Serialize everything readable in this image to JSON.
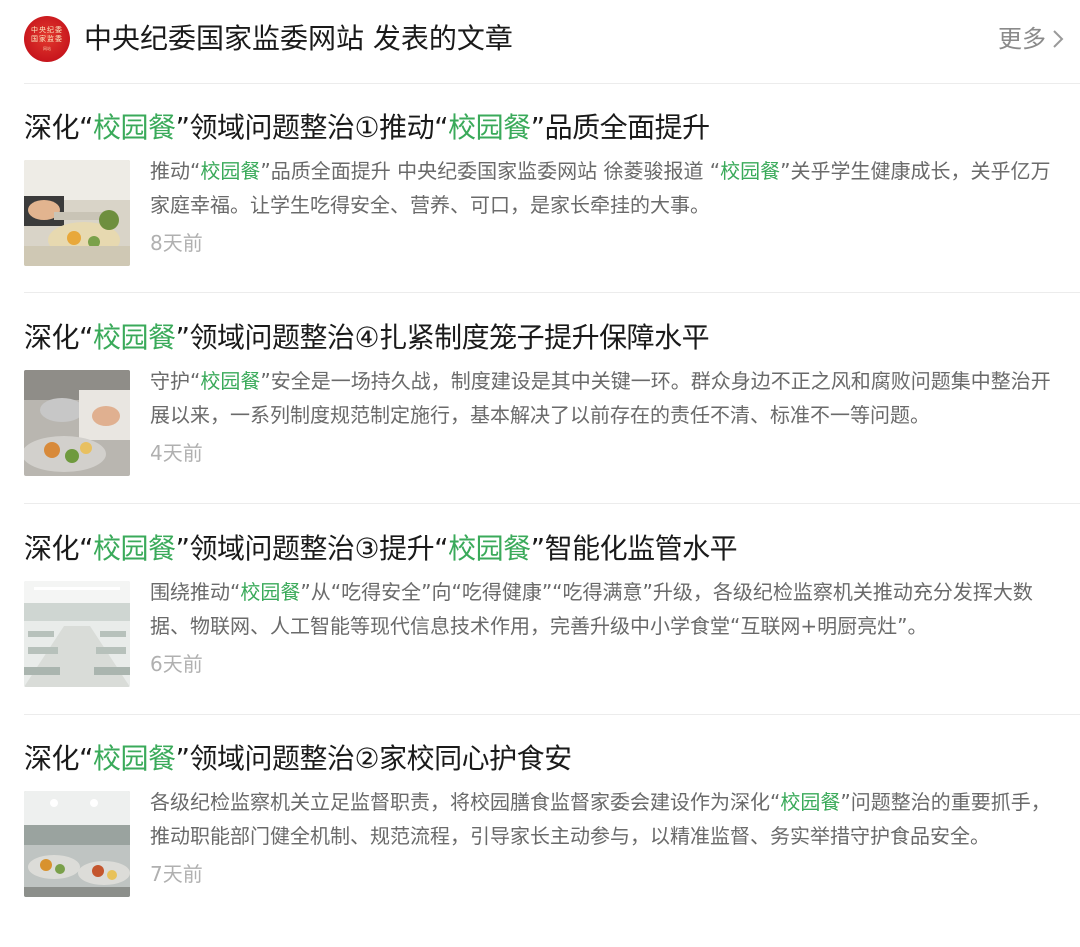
{
  "header": {
    "avatar_text": [
      "中央纪委",
      "国家监委",
      "网站"
    ],
    "title": "中央纪委国家监委网站 发表的文章",
    "more_label": "更多"
  },
  "colors": {
    "highlight": "#3aaa5a",
    "brand_red": "#c8161d"
  },
  "articles": [
    {
      "title": [
        {
          "t": "深化“",
          "h": false
        },
        {
          "t": "校园餐",
          "h": true
        },
        {
          "t": "”领域问题整治①推动“",
          "h": false
        },
        {
          "t": "校园餐",
          "h": true
        },
        {
          "t": "”品质全面提升",
          "h": false
        }
      ],
      "summary": [
        {
          "t": "推动“",
          "h": false
        },
        {
          "t": "校园餐",
          "h": true
        },
        {
          "t": "”品质全面提升 中央纪委国家监委网站 徐菱骏报道 “",
          "h": false
        },
        {
          "t": "校园餐",
          "h": true
        },
        {
          "t": "”关乎学生健康成长，关乎亿万家庭幸福。让学生吃得安全、营养、可口，是家长牵挂的大事。",
          "h": false
        }
      ],
      "time": "8天前",
      "thumb_icon": "cafeteria-food-photo-icon"
    },
    {
      "title": [
        {
          "t": "深化“",
          "h": false
        },
        {
          "t": "校园餐",
          "h": true
        },
        {
          "t": "”领域问题整治④扎紧制度笼子提升保障水平",
          "h": false
        }
      ],
      "summary": [
        {
          "t": "守护“",
          "h": false
        },
        {
          "t": "校园餐",
          "h": true
        },
        {
          "t": "”安全是一场持久战，制度建设是其中关键一环。群众身边不正之风和腐败问题集中整治开展以来，一系列制度规范制定施行，基本解决了以前存在的责任不清、标准不一等问题。",
          "h": false
        }
      ],
      "time": "4天前",
      "thumb_icon": "serving-food-photo-icon"
    },
    {
      "title": [
        {
          "t": "深化“",
          "h": false
        },
        {
          "t": "校园餐",
          "h": true
        },
        {
          "t": "”领域问题整治③提升“",
          "h": false
        },
        {
          "t": "校园餐",
          "h": true
        },
        {
          "t": "”智能化监管水平",
          "h": false
        }
      ],
      "summary": [
        {
          "t": "围绕推动“",
          "h": false
        },
        {
          "t": "校园餐",
          "h": true
        },
        {
          "t": "”从“吃得安全”向“吃得健康”“吃得满意”升级，各级纪检监察机关推动充分发挥大数据、物联网、人工智能等现代信息技术作用，完善升级中小学食堂“互联网+明厨亮灶”。",
          "h": false
        }
      ],
      "time": "6天前",
      "thumb_icon": "canteen-hall-photo-icon"
    },
    {
      "title": [
        {
          "t": "深化“",
          "h": false
        },
        {
          "t": "校园餐",
          "h": true
        },
        {
          "t": "”领域问题整治②家校同心护食安",
          "h": false
        }
      ],
      "summary": [
        {
          "t": "各级纪检监察机关立足监督职责，将校园膳食监督家委会建设作为深化“",
          "h": false
        },
        {
          "t": "校园餐",
          "h": true
        },
        {
          "t": "”问题整治的重要抓手，推动职能部门健全机制、规范流程，引导家长主动参与，以精准监督、务实举措守护食品安全。",
          "h": false
        }
      ],
      "time": "7天前",
      "thumb_icon": "meal-trays-photo-icon"
    }
  ]
}
